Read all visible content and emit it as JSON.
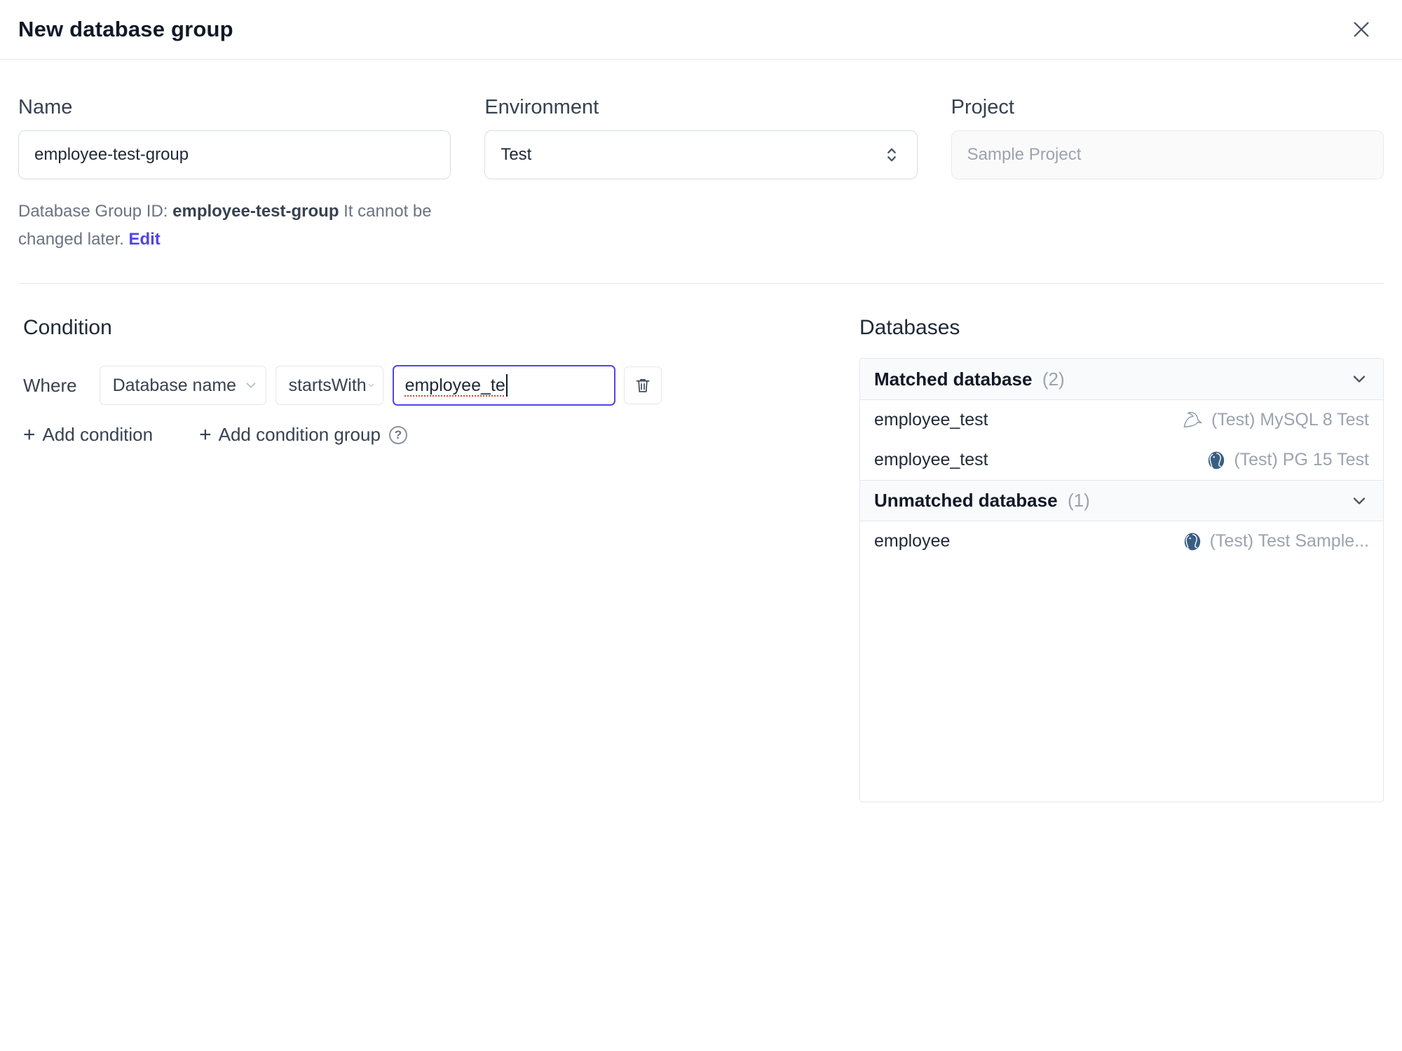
{
  "dialog": {
    "title": "New database group"
  },
  "icons": {
    "plus": "+",
    "help": "?"
  },
  "form": {
    "name": {
      "label": "Name",
      "value": "employee-test-group",
      "helper_prefix": "Database Group ID:",
      "helper_id": "employee-test-group",
      "helper_suffix": "It cannot be changed later.",
      "edit_link": "Edit"
    },
    "environment": {
      "label": "Environment",
      "value": "Test"
    },
    "project": {
      "label": "Project",
      "value": "Sample Project"
    }
  },
  "condition": {
    "heading": "Condition",
    "where_label": "Where",
    "factor_value": "Database name",
    "operator_value": "startsWith",
    "value": "employee_te",
    "add_condition_label": "Add condition",
    "add_condition_group_label": "Add condition group"
  },
  "databases": {
    "heading": "Databases",
    "matched": {
      "label": "Matched database",
      "count": "(2)",
      "rows": [
        {
          "name": "employee_test",
          "engine": "mysql",
          "instance": "(Test) MySQL 8 Test"
        },
        {
          "name": "employee_test",
          "engine": "postgres",
          "instance": "(Test) PG 15 Test"
        }
      ]
    },
    "unmatched": {
      "label": "Unmatched database",
      "count": "(1)",
      "rows": [
        {
          "name": "employee",
          "engine": "postgres",
          "instance": "(Test) Test Sample..."
        }
      ]
    }
  },
  "colors": {
    "accent": "#4f46e5",
    "focus_border": "#4f46e5",
    "muted_text": "#9ca3af",
    "border": "#e5e7eb",
    "header_bg": "#f9fafb"
  }
}
